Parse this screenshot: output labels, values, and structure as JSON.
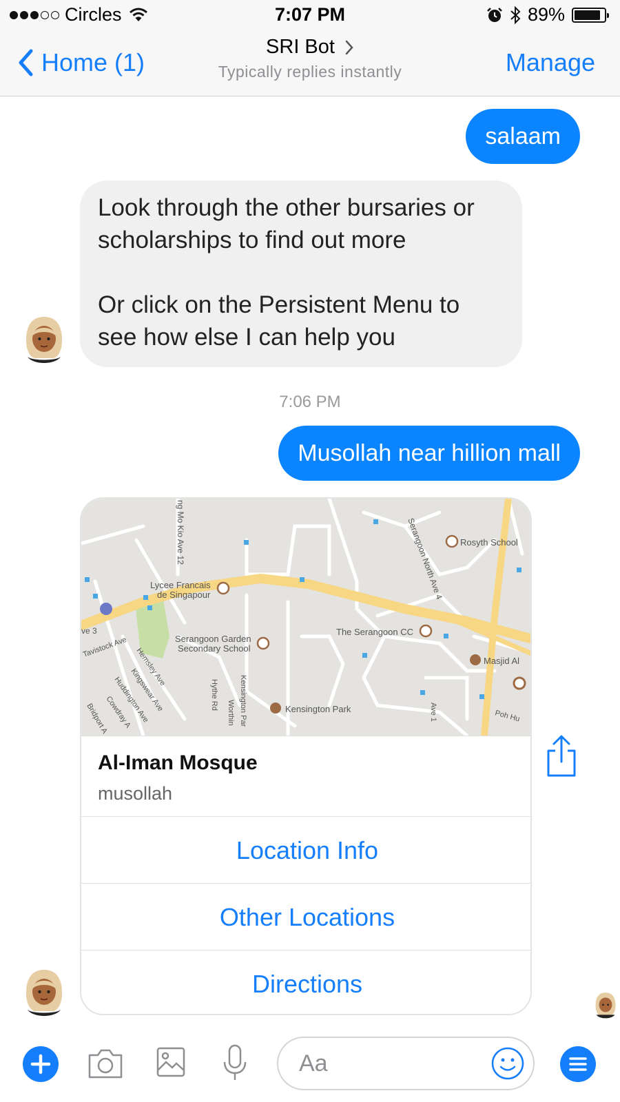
{
  "status_bar": {
    "carrier": "Circles",
    "signal_bars_filled": 3,
    "signal_bars_total": 5,
    "time": "7:07 PM",
    "battery": "89%",
    "battery_level": 0.89,
    "icons": [
      "wifi-icon",
      "alarm-icon",
      "bluetooth-icon",
      "battery-icon"
    ]
  },
  "nav": {
    "back_label": "Home (1)",
    "title": "SRI Bot",
    "subtitle": "Typically replies instantly",
    "manage_label": "Manage"
  },
  "messages": {
    "out_1": "salaam",
    "in_1_para1": "Look through the other bursaries or scholarships to find out more",
    "in_1_para2": "Or click on the Persistent Menu to see how else I can help you",
    "timestamp": "7:06 PM",
    "out_2": "Musollah near hillion mall"
  },
  "map_labels": {
    "road_1": "ng Mo Kio Ave 12",
    "road_2": "Serangoon North Ave 4",
    "poi_1": "Rosyth School",
    "poi_2_line1": "Lycee Francais",
    "poi_2_line2": "de Singapour",
    "poi_3_line1": "Serangoon Garden",
    "poi_3_line2": "Secondary School",
    "poi_4": "The Serangoon CC",
    "poi_5": "Masjid Al",
    "poi_6": "Kensington Park",
    "road_3": "ve 3",
    "road_4": "Tavistock Ave",
    "road_5": "Hemsley Ave",
    "road_6": "Kingswear Ave",
    "road_7": "Huddington Ave",
    "road_8": "Cowdray A",
    "road_9": "Bridport A",
    "road_10": "Hythe Rd",
    "road_11": "Worthin",
    "road_12": "Kensington Par",
    "road_13": "Poh Hu",
    "road_14": "Ave 1"
  },
  "card": {
    "title": "Al-Iman Mosque",
    "subtitle": "musollah",
    "buttons": [
      "Location Info",
      "Other Locations",
      "Directions"
    ]
  },
  "composer": {
    "placeholder": "Aa",
    "icons": [
      "plus-icon",
      "camera-icon",
      "image-icon",
      "microphone-icon",
      "emoji-icon",
      "menu-icon"
    ]
  },
  "colors": {
    "accent": "#147efb",
    "bubble_out": "#0b84ff",
    "bubble_in": "#f1f0f0"
  }
}
